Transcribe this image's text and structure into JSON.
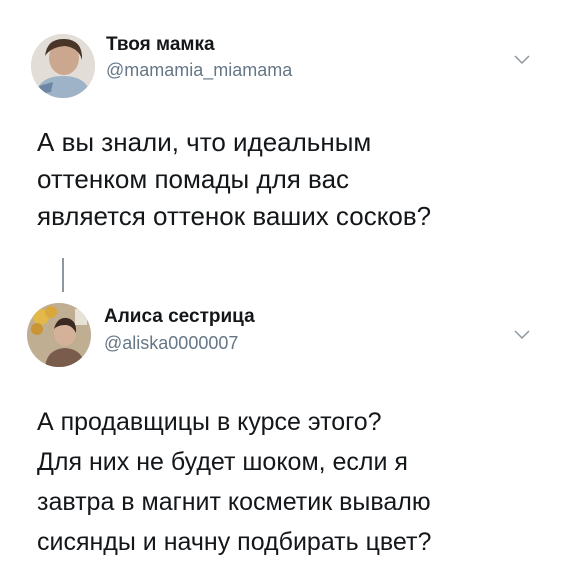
{
  "tweets": [
    {
      "display_name": "Твоя мамка",
      "handle": "@mamamia_miamama",
      "text": "А вы знали, что идеальным\nоттенком помады для вас\nявляется оттенок ваших сосков?"
    },
    {
      "display_name": "Алиса сестрица",
      "handle": "@aliska0000007",
      "text": "А продавщицы в курсе этого?\nДля них не будет шоком, если я\nзавтра в магнит косметик вывалю\nсисянды и начну подбирать цвет?"
    }
  ],
  "icons": {
    "menu": "chevron-down-icon"
  },
  "colors": {
    "text": "#14171a",
    "secondary": "#657786",
    "thread_line": "#8f979e"
  }
}
